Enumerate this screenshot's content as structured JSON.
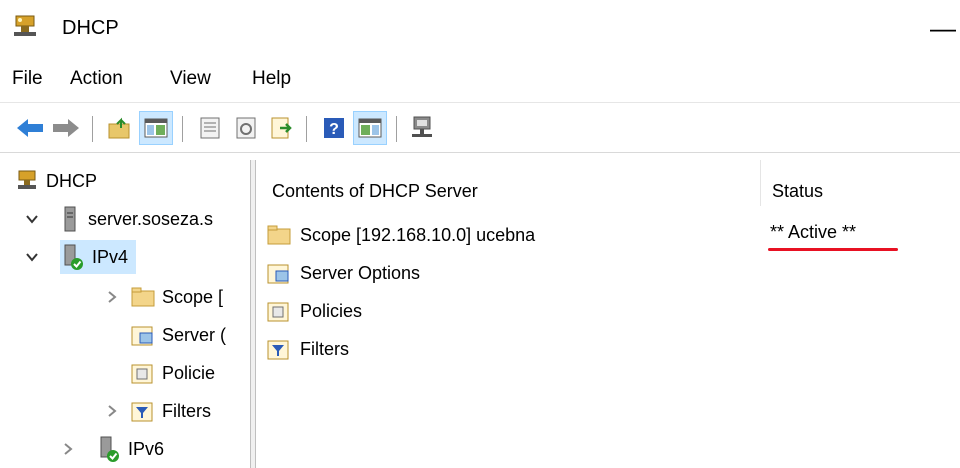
{
  "window": {
    "title": "DHCP",
    "minimize_glyph": "—"
  },
  "menu": {
    "items": [
      "File",
      "Action",
      "View",
      "Help"
    ]
  },
  "toolbar": {
    "icons": [
      "back-arrow-icon",
      "forward-arrow-icon",
      "up-folder-icon",
      "show-hide-tree-icon",
      "properties-icon",
      "refresh-icon",
      "export-list-icon",
      "help-icon",
      "show-action-pane-icon",
      "dhcp-server-icon"
    ]
  },
  "tree": {
    "root": "DHCP",
    "server": "server.soseza.s",
    "ipv4": "IPv4",
    "children": [
      "Scope [",
      "Server (",
      "Policie",
      "Filters"
    ],
    "ipv6": "IPv6"
  },
  "content": {
    "col_name": "Contents of DHCP Server",
    "col_status": "Status",
    "rows": [
      "Scope [192.168.10.0] ucebna",
      "Server Options",
      "Policies",
      "Filters"
    ],
    "scope_status": "** Active **"
  },
  "colors": {
    "selection": "#cce8ff",
    "annotation_underline": "#e81123"
  }
}
